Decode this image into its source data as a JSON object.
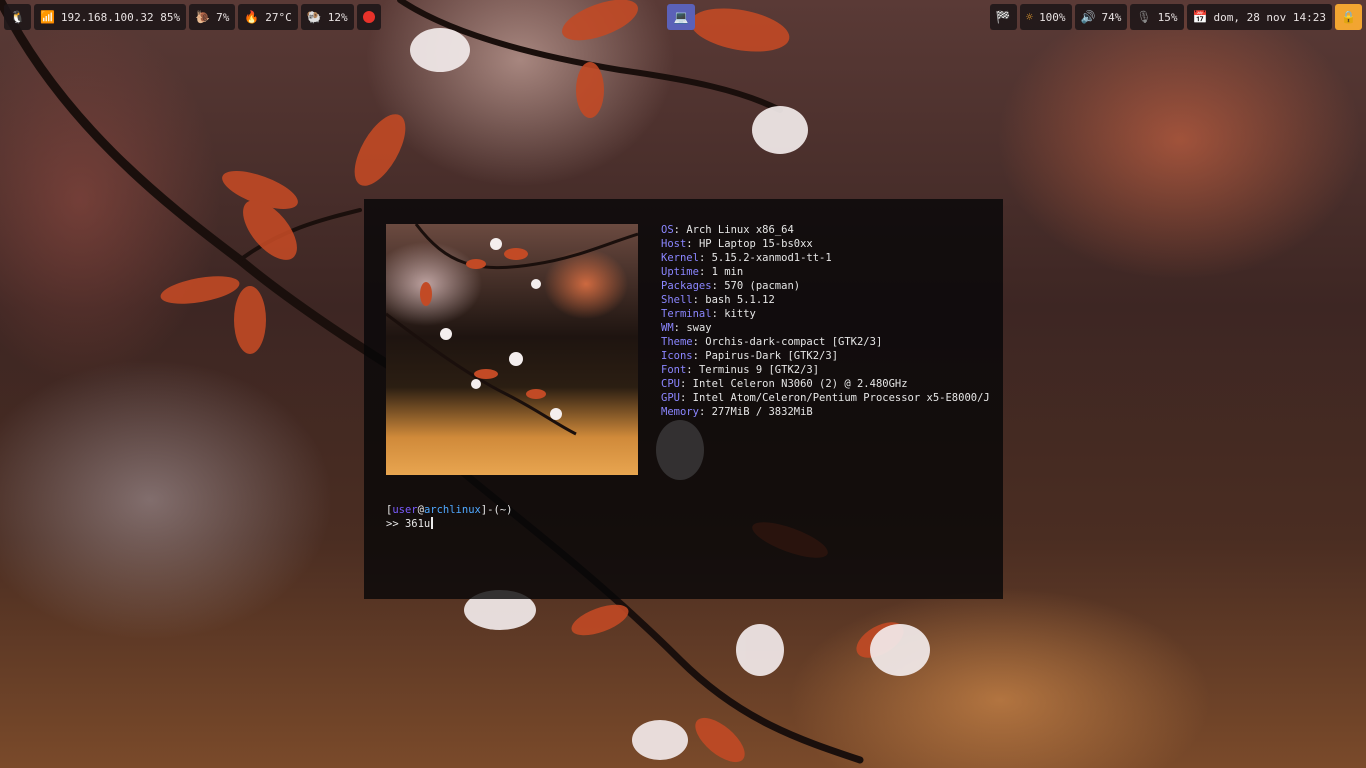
{
  "bar_left": {
    "network": "192.168.100.32 85%",
    "cpu": "7%",
    "temperature": "27°C",
    "memory": "12%"
  },
  "bar_center": {
    "workspace_icon": "laptop-icon"
  },
  "bar_right": {
    "brightness": "100%",
    "volume": "74%",
    "mic": "15%",
    "clock": "dom, 28 nov 14:23"
  },
  "neofetch": {
    "os": {
      "key": "OS",
      "value": "Arch Linux x86_64"
    },
    "host": {
      "key": "Host",
      "value": "HP Laptop 15-bs0xx"
    },
    "kernel": {
      "key": "Kernel",
      "value": "5.15.2-xanmod1-tt-1"
    },
    "uptime": {
      "key": "Uptime",
      "value": "1 min"
    },
    "packages": {
      "key": "Packages",
      "value": "570 (pacman)"
    },
    "shell": {
      "key": "Shell",
      "value": "bash 5.1.12"
    },
    "terminal": {
      "key": "Terminal",
      "value": "kitty"
    },
    "wm": {
      "key": "WM",
      "value": "sway"
    },
    "theme": {
      "key": "Theme",
      "value": "Orchis-dark-compact [GTK2/3]"
    },
    "icons": {
      "key": "Icons",
      "value": "Papirus-Dark [GTK2/3]"
    },
    "font": {
      "key": "Font",
      "value": "Terminus 9 [GTK2/3]"
    },
    "cpu": {
      "key": "CPU",
      "value": "Intel Celeron N3060 (2) @ 2.480GHz"
    },
    "gpu": {
      "key": "GPU",
      "value": "Intel Atom/Celeron/Pentium Processor x5-E8000/J"
    },
    "memory": {
      "key": "Memory",
      "value": "277MiB / 3832MiB"
    }
  },
  "prompt": {
    "open": "[",
    "user": "user",
    "at": "@",
    "host": "archlinux",
    "close": "]-(~)",
    "arrow": ">> ",
    "input": "361u"
  },
  "colors": {
    "bar_bg": "#1c1618",
    "workspace_active": "#5b61b8",
    "lock": "#f2a531",
    "label_key": "#8b86ff",
    "prompt_user": "#7a5cff",
    "prompt_host": "#4fa8ff",
    "record": "#e8322a"
  }
}
